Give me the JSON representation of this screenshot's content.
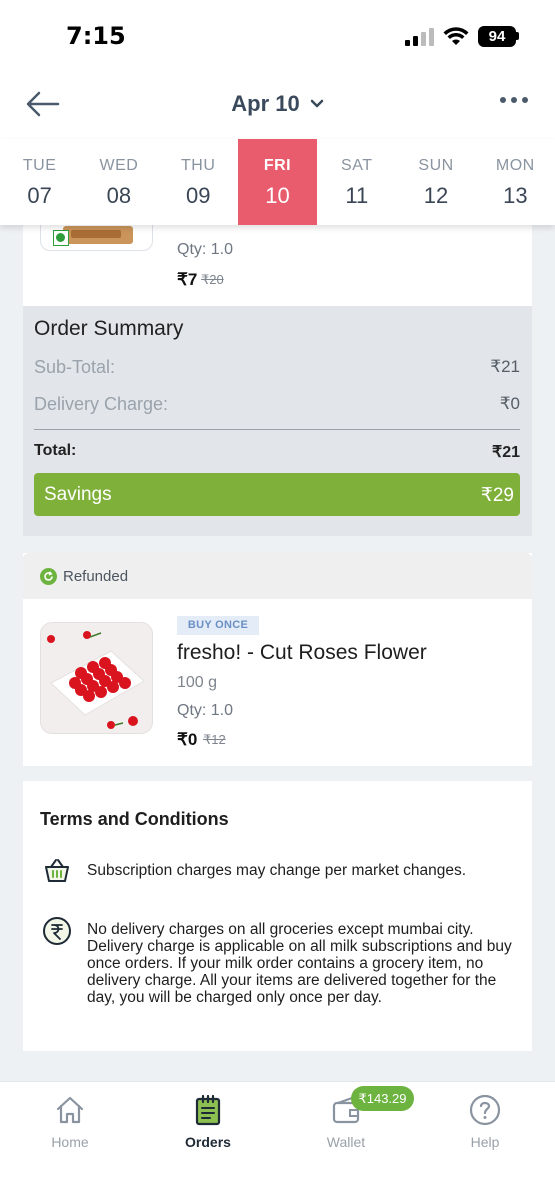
{
  "status_bar": {
    "time": "7:15",
    "battery": "94"
  },
  "header": {
    "title": "Apr 10"
  },
  "days": [
    {
      "name": "TUE",
      "num": "07"
    },
    {
      "name": "WED",
      "num": "08"
    },
    {
      "name": "THU",
      "num": "09"
    },
    {
      "name": "FRI",
      "num": "10"
    },
    {
      "name": "SAT",
      "num": "11"
    },
    {
      "name": "SUN",
      "num": "12"
    },
    {
      "name": "MON",
      "num": "13"
    }
  ],
  "selected_day": "FRI",
  "order_item_1": {
    "qty": "Qty: 1.0",
    "price": "₹7",
    "mrp": "₹20"
  },
  "order_summary": {
    "title": "Order Summary",
    "subtotal_label": "Sub-Total:",
    "subtotal_value": "₹21",
    "delivery_label": "Delivery Charge:",
    "delivery_value": "₹0",
    "total_label": "Total:",
    "total_value": "₹21",
    "savings_label": "Savings",
    "savings_value": "₹29"
  },
  "refunded_order": {
    "status": "Refunded",
    "badge": "BUY ONCE",
    "name": "fresho! - Cut Roses Flower",
    "weight": "100 g",
    "qty": "Qty: 1.0",
    "price": "₹0",
    "mrp": "₹12"
  },
  "terms": {
    "title": "Terms and Conditions",
    "item1": "Subscription charges may change per market changes.",
    "item2": "No delivery charges on all groceries except mumbai city. Delivery charge is applicable on all milk subscriptions and buy once orders. If your milk order contains a grocery item, no delivery charge. All your items are delivered together for the day, you will be charged only once per day."
  },
  "bottom_nav": {
    "home": "Home",
    "orders": "Orders",
    "wallet": "Wallet",
    "help": "Help",
    "wallet_balance": "₹143.29"
  },
  "colors": {
    "accent_selected_day": "#e85c6d",
    "savings_green": "#7fb03a",
    "wallet_badge_green": "#6db33f"
  }
}
